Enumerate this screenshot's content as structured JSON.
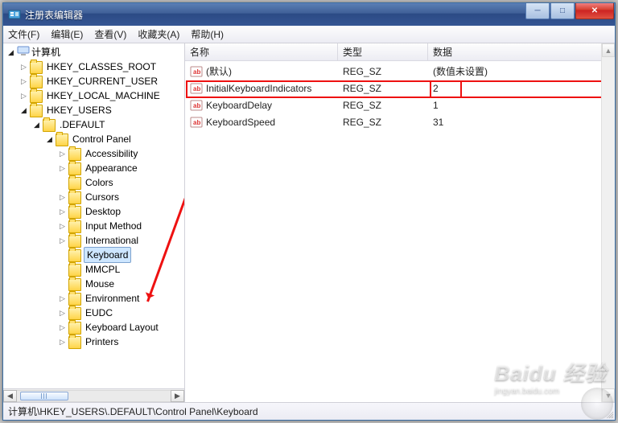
{
  "window": {
    "title": "注册表编辑器"
  },
  "menubar": {
    "items": [
      "文件(F)",
      "编辑(E)",
      "查看(V)",
      "收藏夹(A)",
      "帮助(H)"
    ]
  },
  "tree": {
    "root": "计算机",
    "hives": [
      "HKEY_CLASSES_ROOT",
      "HKEY_CURRENT_USER",
      "HKEY_LOCAL_MACHINE",
      "HKEY_USERS"
    ],
    "hkey_users_default": ".DEFAULT",
    "control_panel": "Control Panel",
    "cp_children": [
      "Accessibility",
      "Appearance",
      "Colors",
      "Cursors",
      "Desktop",
      "Input Method",
      "International",
      "Keyboard",
      "MMCPL",
      "Mouse"
    ],
    "default_siblings_after": [
      "Environment",
      "EUDC",
      "Keyboard Layout",
      "Printers"
    ],
    "selected": "Keyboard"
  },
  "list": {
    "columns": {
      "name": "名称",
      "type": "类型",
      "data": "数据"
    },
    "rows": [
      {
        "name": "(默认)",
        "type": "REG_SZ",
        "data": "(数值未设置)"
      },
      {
        "name": "InitialKeyboardIndicators",
        "type": "REG_SZ",
        "data": "2"
      },
      {
        "name": "KeyboardDelay",
        "type": "REG_SZ",
        "data": "1"
      },
      {
        "name": "KeyboardSpeed",
        "type": "REG_SZ",
        "data": "31"
      }
    ],
    "highlighted_row_index": 1
  },
  "statusbar": {
    "path": "计算机\\HKEY_USERS\\.DEFAULT\\Control Panel\\Keyboard"
  },
  "watermark": {
    "main": "Baidu 经验",
    "sub": "jingyan.baidu.com"
  }
}
